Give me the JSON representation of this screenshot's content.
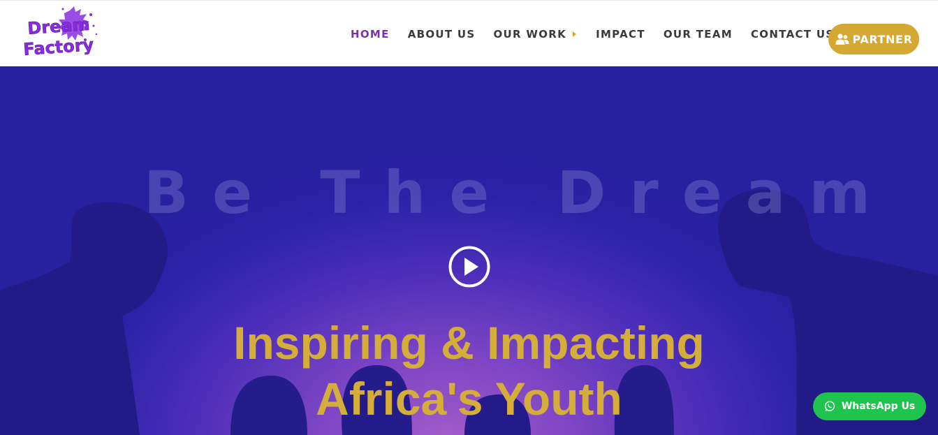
{
  "header": {
    "logo": {
      "line1": "Dream",
      "line2": "Factory"
    },
    "nav": [
      {
        "label": "HOME",
        "active": true
      },
      {
        "label": "ABOUT US"
      },
      {
        "label": "OUR WORK",
        "has_submenu": true
      },
      {
        "label": "IMPACT"
      },
      {
        "label": "OUR TEAM"
      },
      {
        "label": "CONTACT US"
      }
    ],
    "partner_label": "PARTNER"
  },
  "hero": {
    "watermark": "Be The Dream",
    "headline_line1": "Inspiring & Impacting",
    "headline_line2": "Africa's Youth"
  },
  "whatsapp_label": "WhatsApp Us",
  "colors": {
    "accent_purple": "#7a2fb5",
    "gold": "#d4a833",
    "whatsapp_green": "#1fc44f",
    "hero_blue": "#26219f"
  },
  "icons": {
    "partner": "users-icon",
    "play": "play-circle-icon",
    "whatsapp": "whatsapp-icon",
    "submenu": "caret-right-icon"
  }
}
